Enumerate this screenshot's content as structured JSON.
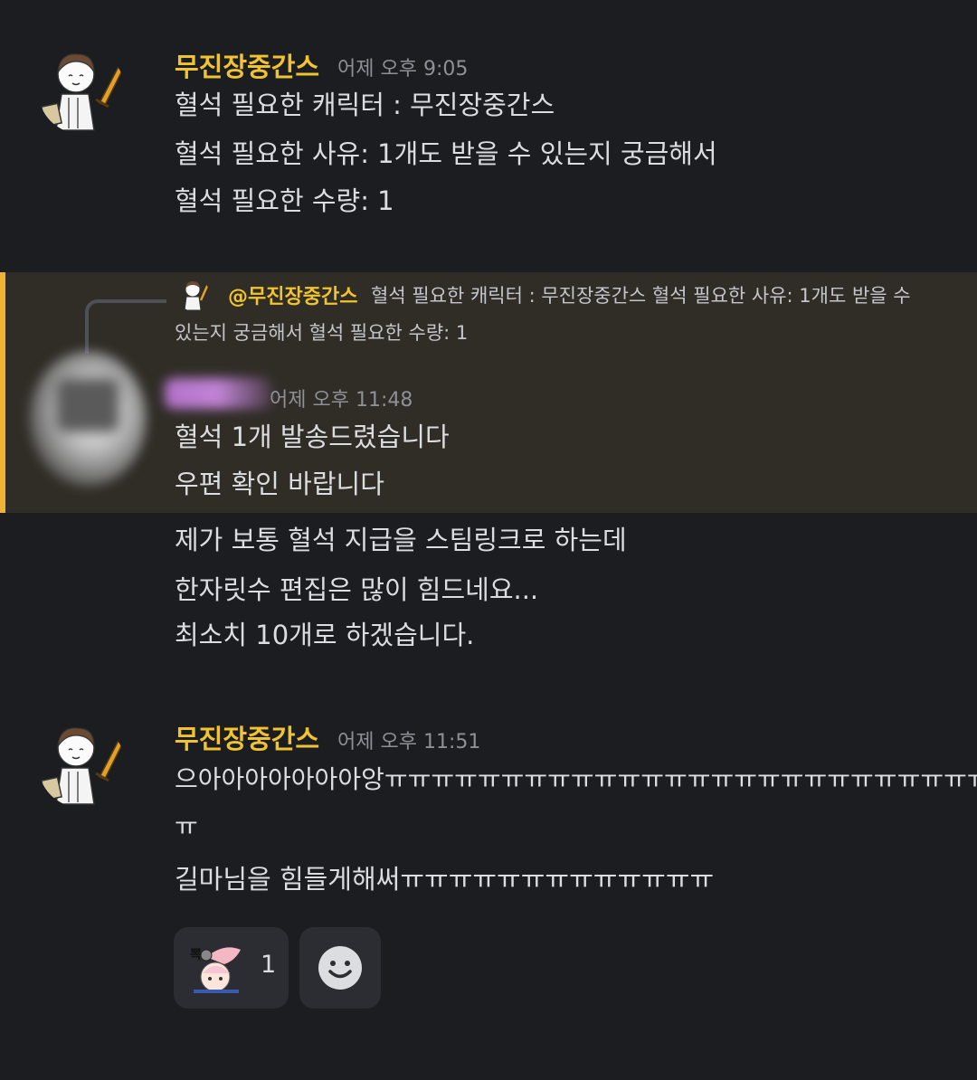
{
  "messages": [
    {
      "username": "무진장중간스",
      "timestamp": "어제 오후 9:05",
      "lines": [
        "혈석 필요한 캐릭터 : 무진장중간스",
        "혈석 필요한 사유: 1개도 받을 수 있는지 궁금해서",
        "혈석 필요한 수량: 1"
      ]
    },
    {
      "reply": {
        "mention": "@무진장중간스",
        "text_line1": "혈석 필요한 캐릭터 : 무진장중간스 혈석 필요한 사유: 1개도 받을 수",
        "text_line2": "있는지 궁금해서 혈석 필요한 수량: 1"
      },
      "timestamp": "어제 오후 11:48",
      "lines": [
        "혈석 1개 발송드렸습니다",
        "우편 확인 바랍니다",
        "제가 보통 혈석 지급을 스팀링크로 하는데",
        "한자릿수 편집은 많이 힘드네요...",
        "최소치 10개로 하겠습니다."
      ]
    },
    {
      "username": "무진장중간스",
      "timestamp": "어제 오후 11:51",
      "lines": [
        "으아아아아아아아앙ㅠㅠㅠㅠㅠㅠㅠㅠㅠㅠㅠㅠㅠㅠㅠㅠㅠㅠㅠㅠㅠㅠㅠㅠㅠㅠㅠ",
        "ㅠ",
        "길마님을 힘들게해써ㅠㅠㅠㅠㅠㅠㅠㅠㅠㅠㅠㅠㅠ"
      ],
      "reactions": [
        {
          "emoji": "custom-emoji-sticker",
          "count": "1"
        }
      ]
    }
  ],
  "icons": {
    "add_reaction": "smile-icon"
  },
  "colors": {
    "background": "#1c1d21",
    "username": "#f0c330",
    "highlight_bg": "#302d27",
    "highlight_bar": "#f0b232",
    "timestamp": "#8e9097"
  }
}
